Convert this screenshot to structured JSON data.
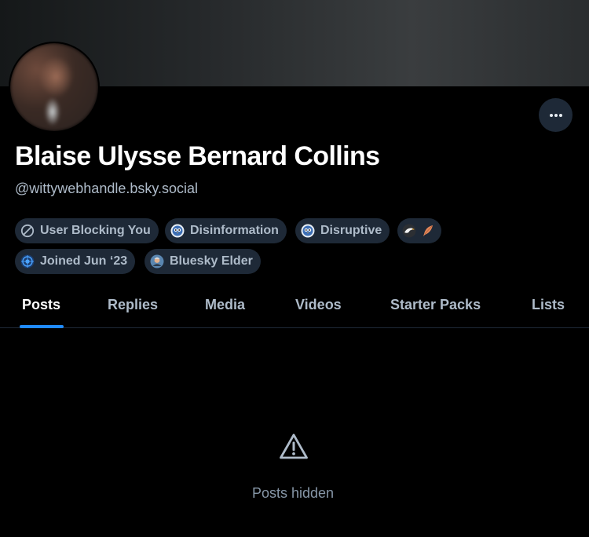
{
  "profile": {
    "display_name": "Blaise Ulysse Bernard Collins",
    "handle": "@wittywebhandle.bsky.social",
    "avatar_alt": "blurred profile avatar"
  },
  "labels": [
    {
      "text": "User Blocking You",
      "icon": "block-icon"
    },
    {
      "text": "Disinformation",
      "icon": "labeler-owl-icon"
    },
    {
      "text": "Disruptive",
      "icon": "labeler-owl-icon"
    },
    {
      "text": "",
      "icon": "eagle-feather-icon"
    },
    {
      "text": "Joined Jun ‘23",
      "icon": "badge-globe-icon"
    },
    {
      "text": "Bluesky Elder",
      "icon": "elder-avatar-icon"
    }
  ],
  "tabs": [
    {
      "label": "Posts",
      "active": true
    },
    {
      "label": "Replies",
      "active": false
    },
    {
      "label": "Media",
      "active": false
    },
    {
      "label": "Videos",
      "active": false
    },
    {
      "label": "Starter Packs",
      "active": false
    },
    {
      "label": "Lists",
      "active": false
    }
  ],
  "empty_state": {
    "icon": "warning-triangle-icon",
    "message": "Posts hidden"
  },
  "colors": {
    "background": "#000000",
    "pill_bg": "#1e2937",
    "accent": "#208bfe",
    "muted_text": "#aebbc9"
  }
}
